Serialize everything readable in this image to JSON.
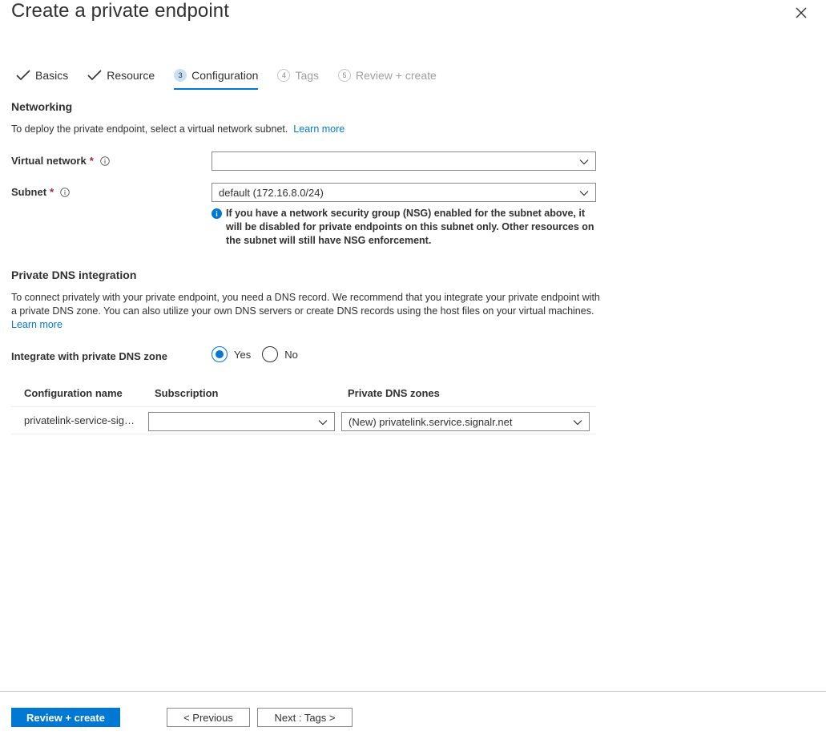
{
  "header": {
    "title": "Create a private endpoint"
  },
  "tabs": [
    {
      "label": "Basics",
      "state": "done"
    },
    {
      "label": "Resource",
      "state": "done"
    },
    {
      "number": "3",
      "label": "Configuration",
      "state": "active"
    },
    {
      "number": "4",
      "label": "Tags",
      "state": "disabled"
    },
    {
      "number": "5",
      "label": "Review + create",
      "state": "disabled"
    }
  ],
  "networking": {
    "heading": "Networking",
    "description": "To deploy the private endpoint, select a virtual network subnet.",
    "learn_more": "Learn more",
    "virtual_network_label": "Virtual network",
    "virtual_network_value": "",
    "subnet_label": "Subnet",
    "subnet_value": "default (172.16.8.0/24)",
    "required_mark": "*",
    "nsg_note": "If you have a network security group (NSG) enabled for the subnet above, it will be disabled for private endpoints on this subnet only. Other resources on the subnet will still have NSG enforcement."
  },
  "dns": {
    "heading": "Private DNS integration",
    "description": "To connect privately with your private endpoint, you need a DNS record. We recommend that you integrate your private endpoint with a private DNS zone. You can also utilize your own DNS servers or create DNS records using the host files on your virtual machines.",
    "learn_more": "Learn more",
    "integrate_label": "Integrate with private DNS zone",
    "options": [
      "Yes",
      "No"
    ],
    "selected": "Yes",
    "columns": [
      "Configuration name",
      "Subscription",
      "Private DNS zones"
    ],
    "rows": [
      {
        "configuration_name": "privatelink-service-signalr-net",
        "subscription": "",
        "private_dns_zone": "(New) privatelink.service.signalr.net"
      }
    ]
  },
  "footer": {
    "review_create": "Review + create",
    "previous": "< Previous",
    "next": "Next : Tags >"
  },
  "colors": {
    "accent": "#0078d4",
    "required": "#a4262c"
  }
}
